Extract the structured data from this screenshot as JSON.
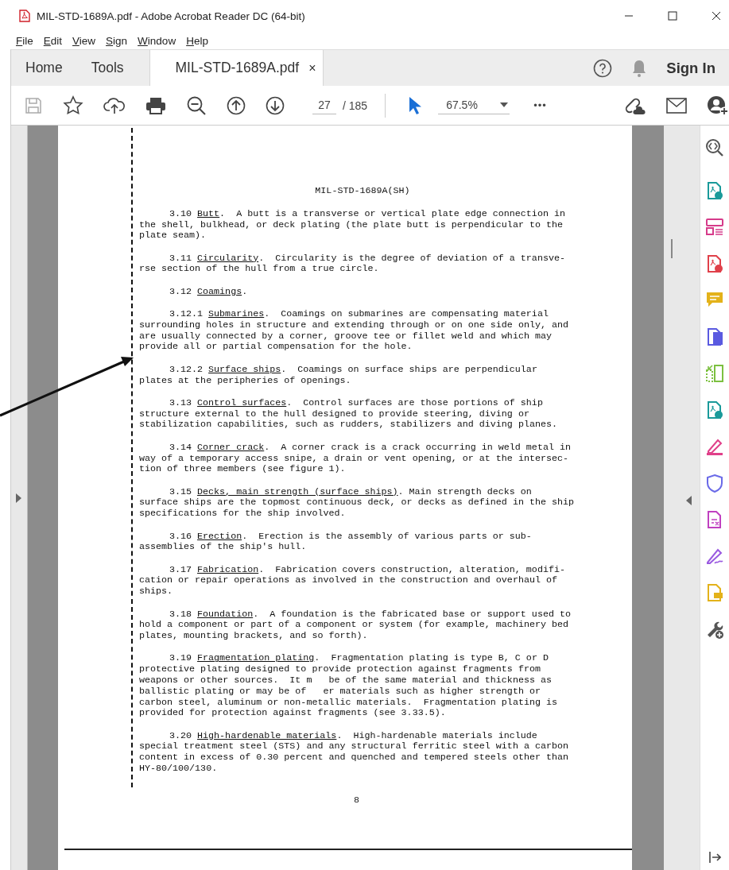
{
  "window": {
    "title": "MIL-STD-1689A.pdf - Adobe Acrobat Reader DC (64-bit)"
  },
  "menu": [
    "File",
    "Edit",
    "View",
    "Sign",
    "Window",
    "Help"
  ],
  "tabs": [
    {
      "label": "Home",
      "selected": false
    },
    {
      "label": "Tools",
      "selected": false
    },
    {
      "label": "MIL-STD-1689A.pdf",
      "selected": true,
      "close": "×"
    }
  ],
  "sign_in": "Sign In",
  "toolbar": {
    "page": "27",
    "page_total": "/ 185",
    "zoom": "67.5%",
    "more": "•••"
  },
  "document": {
    "header": "MIL-STD-1689A(SH)",
    "page_number": "8",
    "paragraphs": [
      {
        "number": "3.10",
        "term": "Butt",
        "lines": [
          ".  A butt is a transverse or vertical plate edge connection in",
          "the shell, bulkhead, or deck plating (the plate butt is perpendicular to the",
          "plate seam)."
        ]
      },
      {
        "number": "3.11",
        "term": "Circularity",
        "lines": [
          ".  Circularity is the degree of deviation of a transve-",
          "rse section of the hull from a true circle."
        ]
      },
      {
        "number": "3.12",
        "term": "Coamings",
        "lines": [
          "."
        ]
      },
      {
        "number": "3.12.1",
        "term": "Submarines",
        "lines": [
          ".  Coamings on submarines are compensating material",
          "surrounding holes in structure and extending through or on one side only, and",
          "are usually connected by a corner, groove tee or fillet weld and which may",
          "provide all or partial compensation for the hole."
        ]
      },
      {
        "number": "3.12.2",
        "term": "Surface ships",
        "lines": [
          ".  Coamings on surface ships are perpendicular",
          "plates at the peripheries of openings."
        ]
      },
      {
        "number": "3.13",
        "term": "Control surfaces",
        "lines": [
          ".  Control surfaces are those portions of ship",
          "structure external to the hull designed to provide steering, diving or",
          "stabilization capabilities, such as rudders, stabilizers and diving planes."
        ]
      },
      {
        "number": "3.14",
        "term": "Corner crack",
        "lines": [
          ".  A corner crack is a crack occurring in weld metal in",
          "way of a temporary access snipe, a drain or vent opening, or at the intersec-",
          "tion of three members (see figure 1)."
        ]
      },
      {
        "number": "3.15",
        "term": "Decks, main strength (surface ships)",
        "lines": [
          ". Main strength decks on",
          "surface ships are the topmost continuous deck, or decks as defined in the ship",
          "specifications for the ship involved."
        ]
      },
      {
        "number": "3.16",
        "term": "Erection",
        "lines": [
          ".  Erection is the assembly of various parts or sub-",
          "assemblies of the ship's hull."
        ]
      },
      {
        "number": "3.17",
        "term": "Fabrication",
        "lines": [
          ".  Fabrication covers construction, alteration, modifi-",
          "cation or repair operations as involved in the construction and overhaul of",
          "ships."
        ]
      },
      {
        "number": "3.18",
        "term": "Foundation",
        "lines": [
          ".  A foundation is the fabricated base or support used to",
          "hold a component or part of a component or system (for example, machinery bed",
          "plates, mounting brackets, and so forth)."
        ]
      },
      {
        "number": "3.19",
        "term": "Fragmentation plating",
        "lines": [
          ".  Fragmentation plating is type B, C or D",
          "protective plating designed to provide protection against fragments from",
          "weapons or other sources.  It m   be of the same material and thickness as",
          "ballistic plating or may be of   er materials such as higher strength or",
          "carbon steel, aluminum or non-metallic materials.  Fragmentation plating is",
          "provided for protection against fragments (see 3.33.5)."
        ]
      },
      {
        "number": "3.20",
        "term": "High-hardenable materials",
        "lines": [
          ".  High-hardenable materials include",
          "special treatment steel (STS) and any structural ferritic steel with a carbon",
          "content in excess of 0.30 percent and quenched and tempered steels other than",
          "HY-80/100/130."
        ]
      }
    ]
  }
}
